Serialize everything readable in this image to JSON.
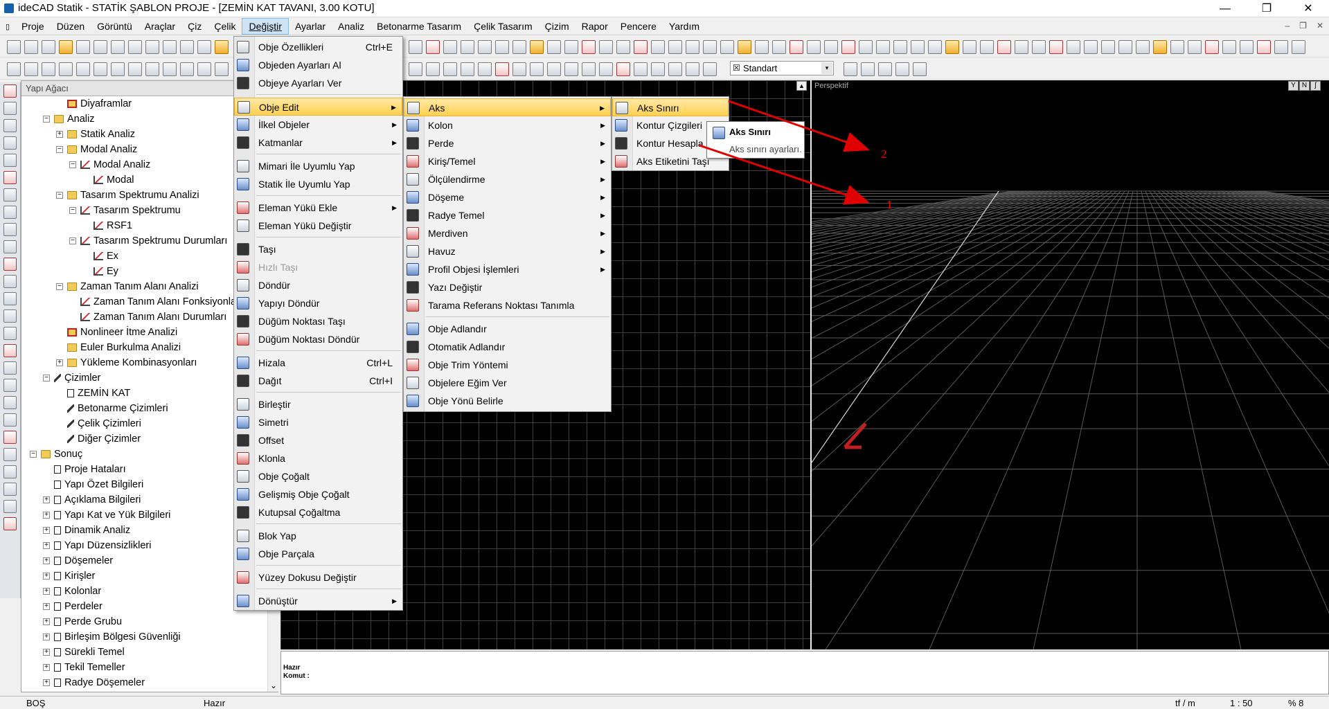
{
  "window": {
    "title": "ideCAD Statik - STATİK ŞABLON PROJE - [ZEMİN KAT TAVANI,  3.00 KOTU]",
    "minimize": "—",
    "restore": "❐",
    "close": "✕",
    "mdi_min": "–",
    "mdi_restore": "❐",
    "mdi_close": "✕"
  },
  "menubar": [
    "Proje",
    "Düzen",
    "Görüntü",
    "Araçlar",
    "Çiz",
    "Çelik",
    "Değiştir",
    "Ayarlar",
    "Analiz",
    "Betonarme Tasarım",
    "Çelik Tasarım",
    "Çizim",
    "Rapor",
    "Pencere",
    "Yardım"
  ],
  "active_menu": "Değiştir",
  "toolbar": {
    "style_combo": "Standart",
    "style_dropdown": "▾"
  },
  "tree": {
    "header": "Yapı Ağacı",
    "scroll_down": "⌄",
    "items": [
      {
        "label": "Diyaframlar",
        "indent": 2,
        "exp": "",
        "icon": "folderr"
      },
      {
        "label": "Analiz",
        "indent": 1,
        "exp": "−",
        "icon": "folder"
      },
      {
        "label": "Statik Analiz",
        "indent": 2,
        "exp": "+",
        "icon": "folder"
      },
      {
        "label": "Modal Analiz",
        "indent": 2,
        "exp": "−",
        "icon": "folder"
      },
      {
        "label": "Modal Analiz",
        "indent": 3,
        "exp": "−",
        "icon": "graph"
      },
      {
        "label": "Modal",
        "indent": 4,
        "exp": "",
        "icon": "graph"
      },
      {
        "label": "Tasarım Spektrumu Analizi",
        "indent": 2,
        "exp": "−",
        "icon": "folder"
      },
      {
        "label": "Tasarım Spektrumu",
        "indent": 3,
        "exp": "−",
        "icon": "graph"
      },
      {
        "label": "RSF1",
        "indent": 4,
        "exp": "",
        "icon": "graph"
      },
      {
        "label": "Tasarım Spektrumu Durumları",
        "indent": 3,
        "exp": "−",
        "icon": "graph"
      },
      {
        "label": "Ex",
        "indent": 4,
        "exp": "",
        "icon": "graph"
      },
      {
        "label": "Ey",
        "indent": 4,
        "exp": "",
        "icon": "graph"
      },
      {
        "label": "Zaman Tanım Alanı Analizi",
        "indent": 2,
        "exp": "−",
        "icon": "folder"
      },
      {
        "label": "Zaman Tanım Alanı Fonksiyonları",
        "indent": 3,
        "exp": "",
        "icon": "graph"
      },
      {
        "label": "Zaman Tanım Alanı Durumları",
        "indent": 3,
        "exp": "",
        "icon": "graph"
      },
      {
        "label": "Nonlineer İtme Analizi",
        "indent": 2,
        "exp": "",
        "icon": "folderr"
      },
      {
        "label": "Euler Burkulma Analizi",
        "indent": 2,
        "exp": "",
        "icon": "folder"
      },
      {
        "label": "Yükleme Kombinasyonları",
        "indent": 2,
        "exp": "+",
        "icon": "folder"
      },
      {
        "label": "Çizimler",
        "indent": 1,
        "exp": "−",
        "icon": "pen"
      },
      {
        "label": "ZEMİN KAT",
        "indent": 2,
        "exp": "",
        "icon": "doc"
      },
      {
        "label": "Betonarme Çizimleri",
        "indent": 2,
        "exp": "",
        "icon": "pen"
      },
      {
        "label": "Çelik Çizimleri",
        "indent": 2,
        "exp": "",
        "icon": "pen"
      },
      {
        "label": "Diğer Çizimler",
        "indent": 2,
        "exp": "",
        "icon": "pen"
      },
      {
        "label": "Sonuç",
        "indent": 0,
        "exp": "−",
        "icon": "folder"
      },
      {
        "label": "Proje Hataları",
        "indent": 1,
        "exp": "",
        "icon": "doc"
      },
      {
        "label": "Yapı Özet Bilgileri",
        "indent": 1,
        "exp": "",
        "icon": "doc"
      },
      {
        "label": "Açıklama Bilgileri",
        "indent": 1,
        "exp": "+",
        "icon": "doc"
      },
      {
        "label": "Yapı Kat ve Yük Bilgileri",
        "indent": 1,
        "exp": "+",
        "icon": "doc"
      },
      {
        "label": "Dinamik Analiz",
        "indent": 1,
        "exp": "+",
        "icon": "doc"
      },
      {
        "label": "Yapı Düzensizlikleri",
        "indent": 1,
        "exp": "+",
        "icon": "doc"
      },
      {
        "label": "Döşemeler",
        "indent": 1,
        "exp": "+",
        "icon": "doc"
      },
      {
        "label": "Kirişler",
        "indent": 1,
        "exp": "+",
        "icon": "doc"
      },
      {
        "label": "Kolonlar",
        "indent": 1,
        "exp": "+",
        "icon": "doc"
      },
      {
        "label": "Perdeler",
        "indent": 1,
        "exp": "+",
        "icon": "doc"
      },
      {
        "label": "Perde Grubu",
        "indent": 1,
        "exp": "+",
        "icon": "doc"
      },
      {
        "label": "Birleşim Bölgesi Güvenliği",
        "indent": 1,
        "exp": "+",
        "icon": "doc"
      },
      {
        "label": "Sürekli Temel",
        "indent": 1,
        "exp": "+",
        "icon": "doc"
      },
      {
        "label": "Tekil Temeller",
        "indent": 1,
        "exp": "+",
        "icon": "doc"
      },
      {
        "label": "Radye Döşemeler",
        "indent": 1,
        "exp": "+",
        "icon": "doc"
      }
    ]
  },
  "degistir_menu": [
    {
      "label": "Obje Özellikleri",
      "shortcut": "Ctrl+E"
    },
    {
      "label": "Objeden Ayarları Al"
    },
    {
      "label": "Objeye Ayarları Ver"
    },
    {
      "sep": true
    },
    {
      "label": "Obje Edit",
      "submenu": true,
      "highlight": true
    },
    {
      "label": "İlkel Objeler",
      "submenu": true
    },
    {
      "label": "Katmanlar",
      "submenu": true
    },
    {
      "sep": true
    },
    {
      "label": "Mimari İle Uyumlu Yap"
    },
    {
      "label": "Statik İle Uyumlu Yap"
    },
    {
      "sep": true
    },
    {
      "label": "Eleman Yükü Ekle",
      "submenu": true
    },
    {
      "label": "Eleman Yükü Değiştir"
    },
    {
      "sep": true
    },
    {
      "label": "Taşı"
    },
    {
      "label": "Hızlı Taşı",
      "disabled": true
    },
    {
      "label": "Döndür"
    },
    {
      "label": "Yapıyı Döndür"
    },
    {
      "label": "Düğüm Noktası Taşı"
    },
    {
      "label": "Düğüm Noktası Döndür"
    },
    {
      "sep": true
    },
    {
      "label": "Hizala",
      "shortcut": "Ctrl+L"
    },
    {
      "label": "Dağıt",
      "shortcut": "Ctrl+I"
    },
    {
      "sep": true
    },
    {
      "label": "Birleştir"
    },
    {
      "label": "Simetri"
    },
    {
      "label": "Offset"
    },
    {
      "label": "Klonla"
    },
    {
      "label": "Obje Çoğalt"
    },
    {
      "label": "Gelişmiş Obje Çoğalt"
    },
    {
      "label": "Kutupsal Çoğaltma"
    },
    {
      "sep": true
    },
    {
      "label": "Blok Yap"
    },
    {
      "label": "Obje Parçala"
    },
    {
      "sep": true
    },
    {
      "label": "Yüzey Dokusu Değiştir"
    },
    {
      "sep": true
    },
    {
      "label": "Dönüştür",
      "submenu": true
    }
  ],
  "obje_edit_menu": [
    {
      "label": "Aks",
      "submenu": true,
      "highlight": true
    },
    {
      "label": "Kolon",
      "submenu": true
    },
    {
      "label": "Perde",
      "submenu": true
    },
    {
      "label": "Kiriş/Temel",
      "submenu": true
    },
    {
      "label": "Ölçülendirme",
      "submenu": true
    },
    {
      "label": "Döşeme",
      "submenu": true
    },
    {
      "label": "Radye Temel",
      "submenu": true
    },
    {
      "label": "Merdiven",
      "submenu": true
    },
    {
      "label": "Havuz",
      "submenu": true
    },
    {
      "label": "Profil Objesi İşlemleri",
      "submenu": true
    },
    {
      "label": "Yazı Değiştir"
    },
    {
      "label": "Tarama Referans Noktası Tanımla"
    },
    {
      "sep": true
    },
    {
      "label": "Obje Adlandır"
    },
    {
      "label": "Otomatik Adlandır"
    },
    {
      "label": "Obje Trim Yöntemi"
    },
    {
      "label": "Objelere Eğim Ver"
    },
    {
      "label": "Obje Yönü Belirle"
    }
  ],
  "aks_menu": [
    {
      "label": "Aks Sınırı",
      "highlight": true
    },
    {
      "label": "Kontur Çizgileri"
    },
    {
      "label": "Kontur Hesapla"
    },
    {
      "label": "Aks Etiketini Taşı"
    }
  ],
  "tooltip": {
    "title": "Aks Sınırı",
    "description": "Aks sınırı ayarları."
  },
  "viewport": {
    "perspective_label": "Perspektif",
    "view_buttons": [
      "Y",
      "N",
      "ʃ"
    ],
    "maximize": "▲"
  },
  "annotations": [
    {
      "label": "2",
      "color": "#e00000"
    },
    {
      "label": "1",
      "color": "#e00000"
    }
  ],
  "command": {
    "status": "Hazır",
    "prompt": "Komut :"
  },
  "statusbar": {
    "left": "BOŞ",
    "mid": "Hazır",
    "units": "tf / m",
    "scale": "1 : 50",
    "zoom": "% 8"
  }
}
